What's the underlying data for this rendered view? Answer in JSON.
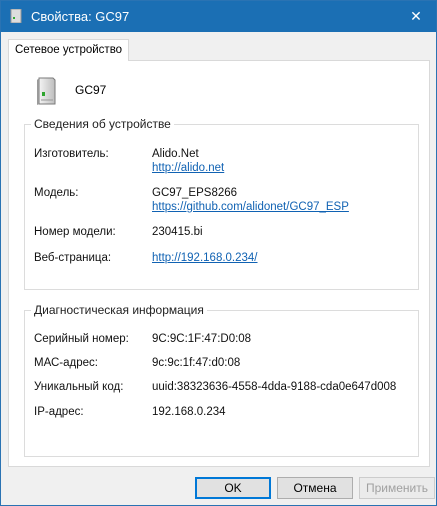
{
  "window": {
    "title": "Свойства: GC97",
    "close_glyph": "✕"
  },
  "tab": {
    "label": "Сетевое устройство"
  },
  "device": {
    "name": "GC97"
  },
  "device_info": {
    "label": "Сведения об устройстве",
    "manufacturer_label": "Изготовитель:",
    "manufacturer_value": "Alido.Net",
    "manufacturer_link": "http://alido.net",
    "model_label": "Модель:",
    "model_value": "GC97_EPS8266",
    "model_link": "https://github.com/alidonet/GC97_ESP",
    "model_number_label": "Номер модели:",
    "model_number_value": "230415.bi",
    "webpage_label": "Веб-страница:",
    "webpage_link": "http://192.168.0.234/"
  },
  "diagnostics": {
    "label": "Диагностическая информация",
    "serial_label": "Серийный номер:",
    "serial_value": "9C:9C:1F:47:D0:08",
    "mac_label": "МАС-адрес:",
    "mac_value": "9c:9c:1f:47:d0:08",
    "uid_label": "Уникальный код:",
    "uid_value": "uuid:38323636-4558-4dda-9188-cda0e647d008",
    "ip_label": "IP-адрес:",
    "ip_value": "192.168.0.234"
  },
  "buttons": {
    "ok": "OK",
    "cancel": "Отмена",
    "apply": "Применить"
  },
  "colors": {
    "titlebar": "#1b6fb4",
    "link": "#1062b3"
  }
}
